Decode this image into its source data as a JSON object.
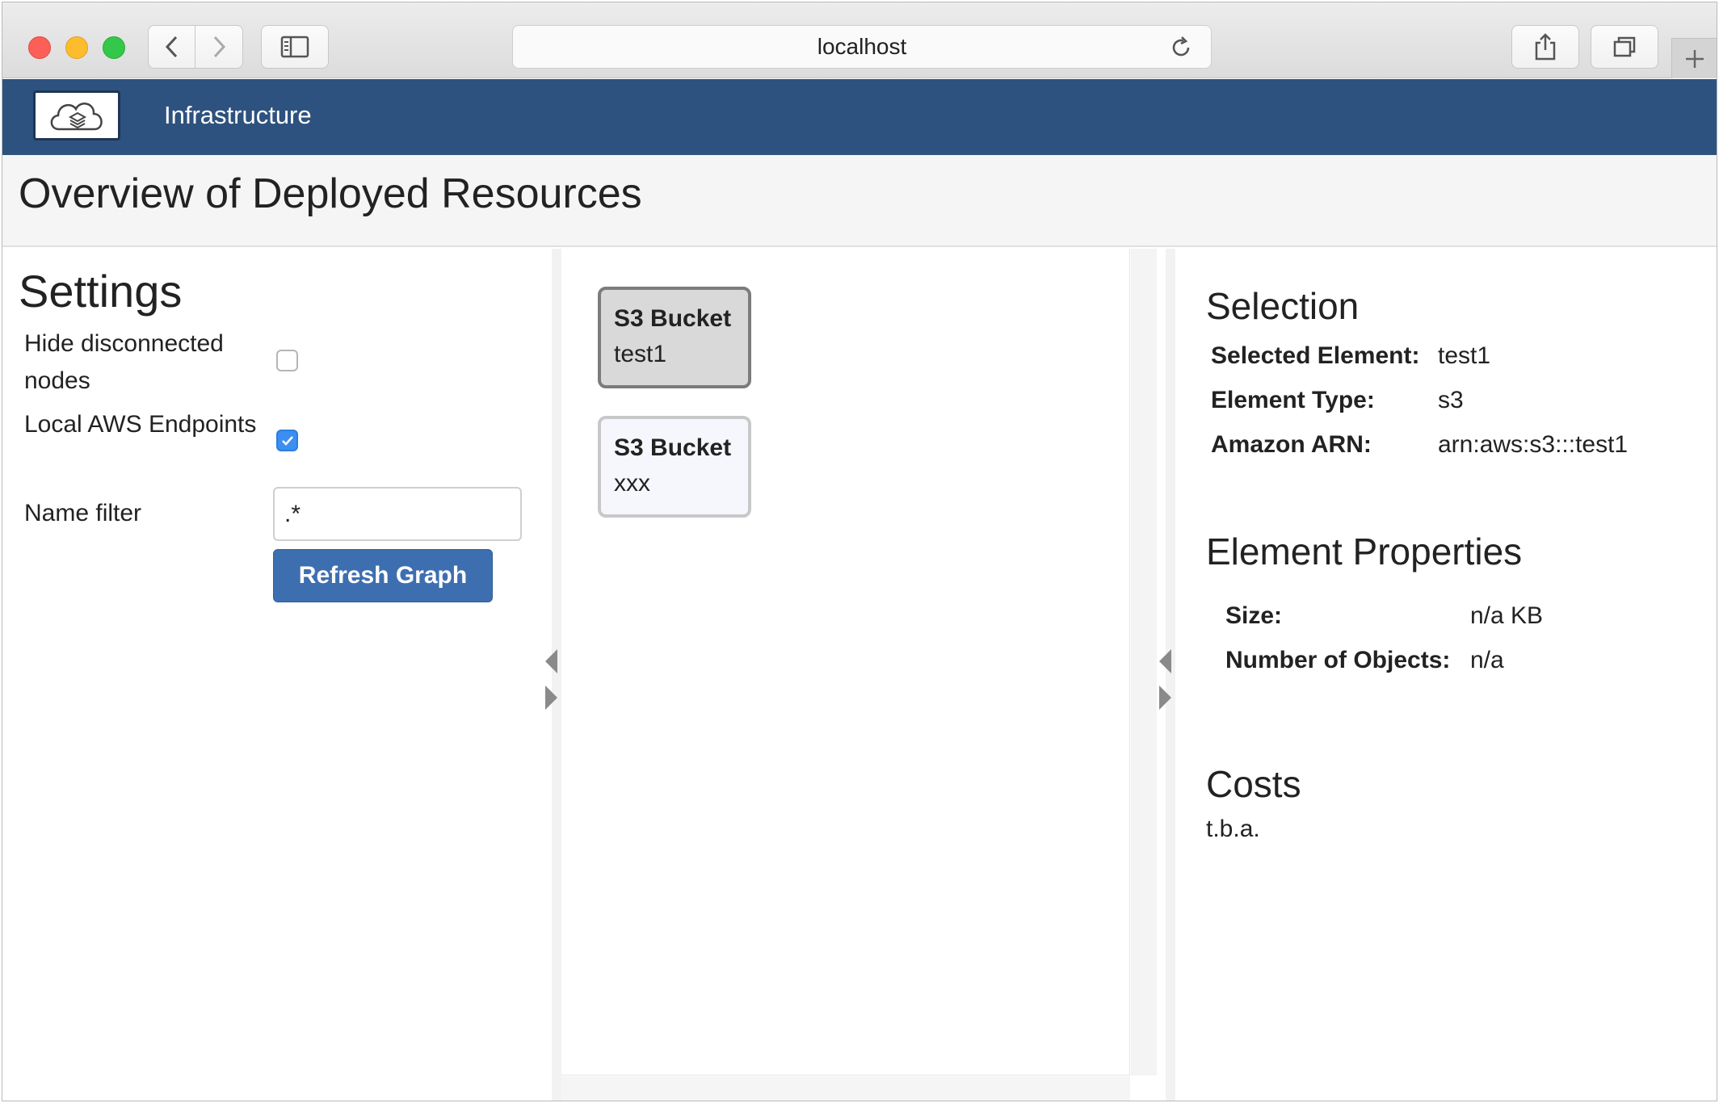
{
  "browser": {
    "address": "localhost"
  },
  "app": {
    "brand": "Infrastructure",
    "page_title": "Overview of Deployed Resources"
  },
  "settings": {
    "title": "Settings",
    "hide_disconnected_label": "Hide disconnected nodes",
    "hide_disconnected_checked": false,
    "local_aws_label": "Local AWS Endpoints",
    "local_aws_checked": true,
    "name_filter_label": "Name filter",
    "name_filter_value": ".*",
    "refresh_label": "Refresh Graph"
  },
  "graph": {
    "nodes": [
      {
        "type": "S3 Bucket",
        "name": "test1",
        "selected": true
      },
      {
        "type": "S3 Bucket",
        "name": "xxx",
        "selected": false
      }
    ]
  },
  "selection": {
    "title": "Selection",
    "rows": [
      {
        "key": "Selected Element:",
        "value": "test1"
      },
      {
        "key": "Element Type:",
        "value": "s3"
      },
      {
        "key": "Amazon ARN:",
        "value": "arn:aws:s3:::test1"
      }
    ]
  },
  "properties": {
    "title": "Element Properties",
    "rows": [
      {
        "key": "Size:",
        "value": "n/a KB"
      },
      {
        "key": "Number of Objects:",
        "value": "n/a"
      }
    ]
  },
  "costs": {
    "title": "Costs",
    "value": "t.b.a."
  },
  "colors": {
    "header_bg": "#2e527f",
    "primary_button": "#3d6fb0",
    "checkbox_checked": "#3b8ff2"
  }
}
